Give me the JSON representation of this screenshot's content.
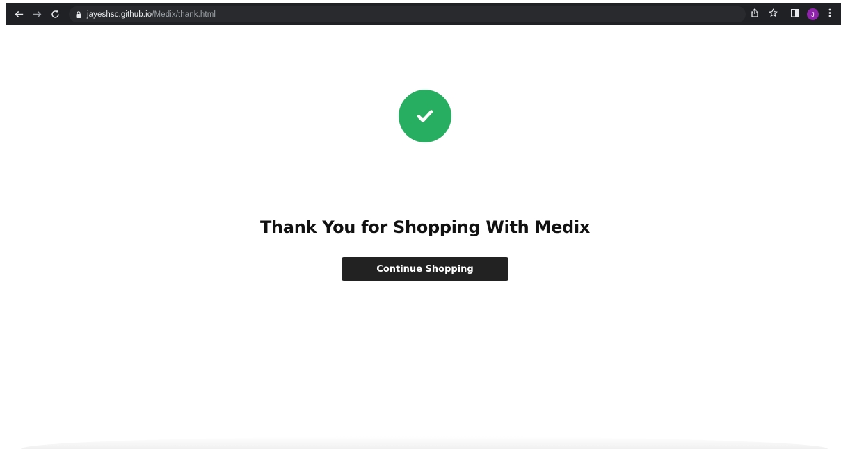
{
  "browser": {
    "url_host": "jayeshsc.github.io",
    "url_path": "/Medix/thank.html",
    "profile_initial": "J",
    "icons": {
      "back": "arrow-left-icon",
      "forward": "arrow-right-icon",
      "reload": "reload-icon",
      "lock": "lock-icon",
      "share": "share-icon",
      "bookmark": "star-icon",
      "side_panel": "side-panel-icon",
      "menu": "kebab-menu-icon"
    },
    "colors": {
      "toolbar": "#202124",
      "omnibox": "#282a2d",
      "avatar": "#8e24aa"
    }
  },
  "main": {
    "title": "Thank You for Shopping With Medix",
    "continue_label": "Continue Shopping",
    "success_icon": "check-circle-icon",
    "colors": {
      "success": "#27ae60",
      "button": "#222222"
    }
  }
}
